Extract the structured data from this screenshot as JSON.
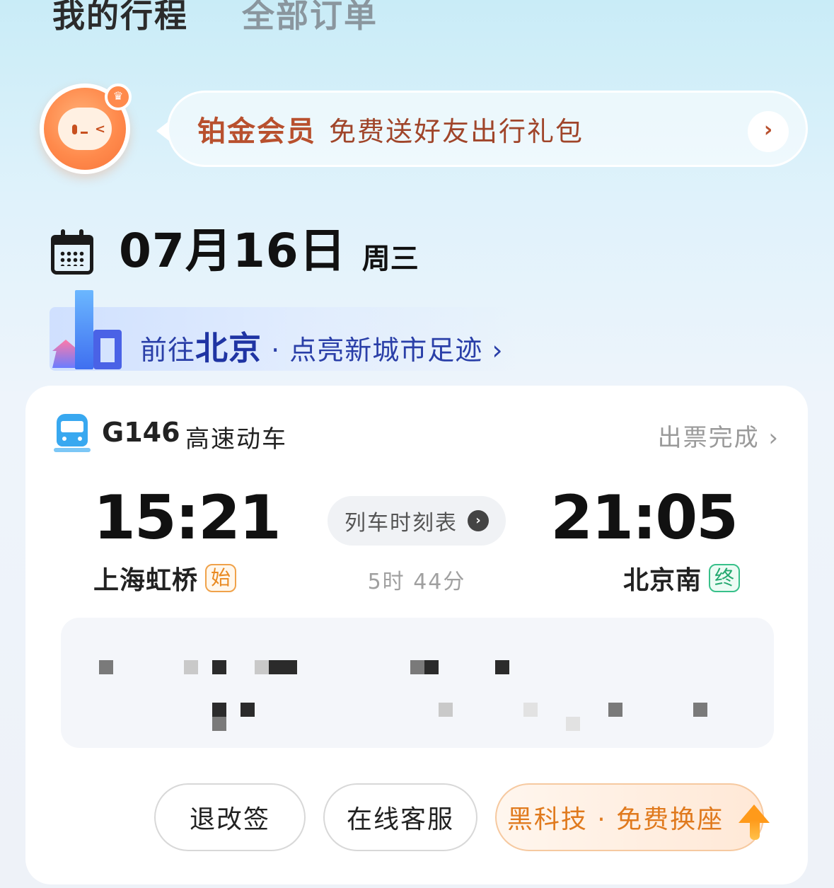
{
  "tabs": [
    {
      "label": "我的行程",
      "active": true
    },
    {
      "label": "全部订单",
      "active": false
    }
  ],
  "member_banner": {
    "title": "铂金会员",
    "subtitle": "免费送好友出行礼包",
    "arrow_icon": "chevron-right-icon",
    "avatar_icon": "mascot-avatar-icon",
    "badge_icon": "crown-icon"
  },
  "trip_date": {
    "date": "07月16日",
    "weekday": "周三",
    "icon": "calendar-icon"
  },
  "destination": {
    "prefix": "前往",
    "city": "北京",
    "suffix": " · 点亮新城市足迹",
    "arrow": "›"
  },
  "ticket": {
    "train_icon": "train-icon",
    "train_no": "G146",
    "train_type": "高速动车",
    "status": "出票完成",
    "status_arrow": "›",
    "departure": {
      "time": "15:21",
      "station": "上海虹桥",
      "tag": "始"
    },
    "arrival": {
      "time": "21:05",
      "station": "北京南",
      "tag": "终"
    },
    "schedule_label": "列车时刻表",
    "schedule_arrow": "›",
    "duration": "5时 44分"
  },
  "actions": {
    "refund": "退改签",
    "service": "在线客服",
    "seat": "黑科技 · 免费换座"
  },
  "colors": {
    "member_accent": "#b8502e",
    "destination": "#1f34a3",
    "train_icon": "#38a8f0",
    "start_tag": "#e98a22",
    "end_tag": "#23a86f",
    "seat_button": "#e07a1e"
  }
}
